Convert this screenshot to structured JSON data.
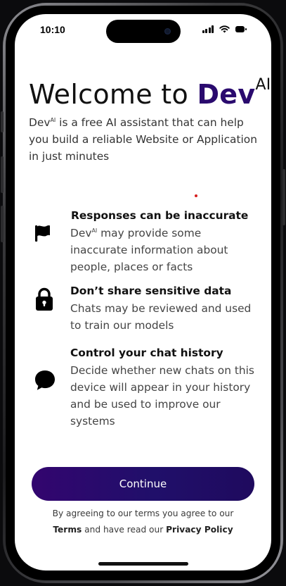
{
  "status_bar": {
    "time": "10:10"
  },
  "welcome": {
    "title_prefix": "Welcome to ",
    "brand_name": "Dev",
    "brand_superscript": "AI",
    "intro_brand": "Dev",
    "intro_brand_sup": "AI",
    "intro_text": " is a free AI assistant that can help you build a reliable Website or Application in just minutes"
  },
  "features": [
    {
      "icon": "flag-icon",
      "title": "Responses can be inaccurate",
      "desc_brand": "Dev",
      "desc_brand_sup": "AI",
      "desc": " may provide some inaccurate information about people, places or facts"
    },
    {
      "icon": "lock-icon",
      "title": "Don’t share sensitive data",
      "desc": "Chats may be reviewed and used to train our models"
    },
    {
      "icon": "chat-bubble-icon",
      "title": "Control your chat history",
      "desc": "Decide whether new chats on this device will appear in your history and be used to improve our systems"
    }
  ],
  "cta": {
    "label": "Continue"
  },
  "legal": {
    "line1": "By agreeing to our terms you agree to our",
    "terms_label": "Terms",
    "middle": " and have read our ",
    "privacy_label": "Privacy Policy"
  },
  "colors": {
    "brand": "#2a0a6e",
    "cta_gradient_start": "#33056f",
    "cta_gradient_end": "#1f0a5e"
  }
}
